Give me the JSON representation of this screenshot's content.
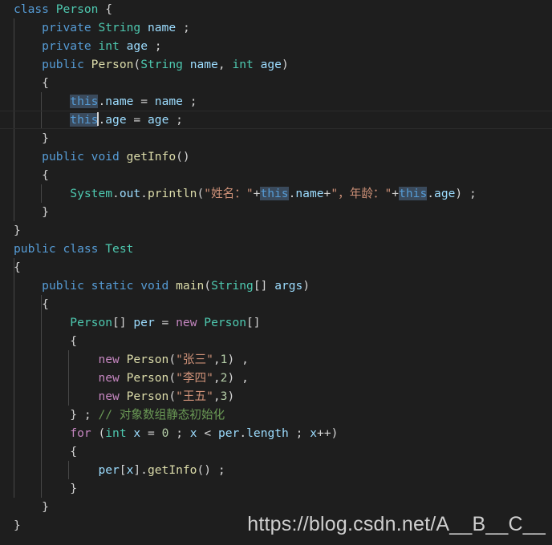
{
  "editor": {
    "background": "#1e1e1e",
    "language": "java",
    "line_height_px": 23,
    "indent_size_spaces": 4,
    "colors": {
      "background": "#1e1e1e",
      "foreground": "#d4d4d4",
      "keyword": "#569cd6",
      "type": "#4ec9b0",
      "function": "#dcdcaa",
      "control": "#c586c0",
      "string": "#ce9178",
      "comment": "#6a9955",
      "variable": "#9cdcfe",
      "number": "#b5cea8",
      "selection": "#3a4a5c",
      "indent_guide": "#474747",
      "current_line_border": "#2b2b2b",
      "watermark": "#cfcfcf"
    },
    "cursor": {
      "line": 6,
      "after_text": "this"
    },
    "current_line": 6,
    "selection_occurrences": [
      "this",
      "this",
      "this",
      "this"
    ]
  },
  "code": {
    "lines": [
      "class Person {",
      "    private String name ;",
      "    private int age ;",
      "    public Person(String name, int age)",
      "    {",
      "        this.name = name ;",
      "        this.age = age ;",
      "    }",
      "    public void getInfo()",
      "    {",
      "        System.out.println(\"姓名：\"+this.name+\"，年龄：\"+this.age) ;",
      "    }",
      "}",
      "public class Test",
      "{",
      "    public static void main(String[] args)",
      "    {",
      "        Person[] per = new Person[]",
      "        {",
      "            new Person(\"张三\",1) ,",
      "            new Person(\"李四\",2) ,",
      "            new Person(\"王五\",3)",
      "        } ; // 对象数组静态初始化",
      "        for (int x = 0 ; x < per.length ; x++)",
      "        {",
      "            per[x].getInfo() ;",
      "        }",
      "    }",
      "}"
    ],
    "strings": {
      "name_label": "\"姓名：\"",
      "age_label": "\"，年龄：\"",
      "person_1": "\"张三\"",
      "person_2": "\"李四\"",
      "person_3": "\"王五\""
    },
    "numbers": {
      "p1": "1",
      "p2": "2",
      "p3": "3",
      "loop_init": "0"
    },
    "comment": "// 对象数组静态初始化",
    "identifiers": {
      "class_person": "Person",
      "class_test": "Test",
      "field_name": "name",
      "field_age": "age",
      "method_get_info": "getInfo",
      "method_main": "main",
      "array_per": "per",
      "loop_var": "x"
    }
  },
  "watermark": {
    "text": "https://blog.csdn.net/A__B__C__"
  }
}
